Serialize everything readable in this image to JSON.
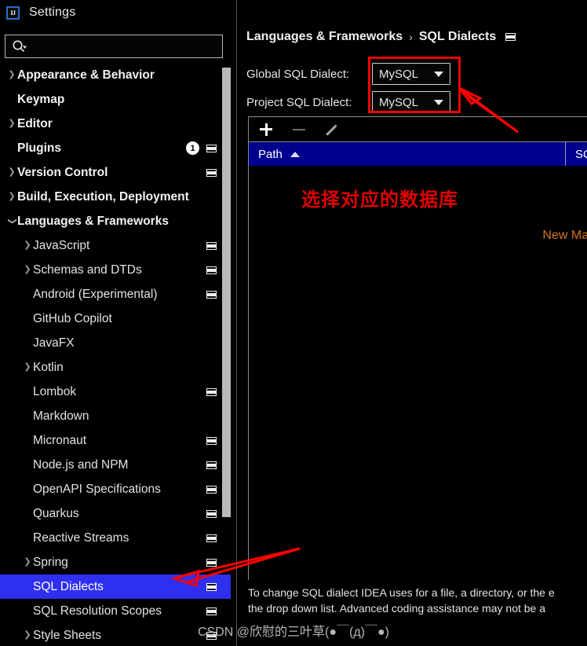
{
  "window": {
    "title": "Settings",
    "app_icon": "intellij-idea-icon"
  },
  "search": {
    "value": "",
    "placeholder": "",
    "icon": "search-icon"
  },
  "sidebar": {
    "scrollbar": "vertical-scrollbar",
    "items": [
      {
        "label": "Appearance & Behavior",
        "level": 0,
        "chevron": "chevron-right",
        "modified_icon": false,
        "badge": null,
        "selected": false
      },
      {
        "label": "Keymap",
        "level": 0,
        "chevron": "",
        "modified_icon": false,
        "badge": null,
        "selected": false
      },
      {
        "label": "Editor",
        "level": 0,
        "chevron": "chevron-right",
        "modified_icon": false,
        "badge": null,
        "selected": false
      },
      {
        "label": "Plugins",
        "level": 0,
        "chevron": "",
        "modified_icon": true,
        "badge": "1",
        "selected": false
      },
      {
        "label": "Version Control",
        "level": 0,
        "chevron": "chevron-right",
        "modified_icon": true,
        "badge": null,
        "selected": false
      },
      {
        "label": "Build, Execution, Deployment",
        "level": 0,
        "chevron": "chevron-right",
        "modified_icon": false,
        "badge": null,
        "selected": false
      },
      {
        "label": "Languages & Frameworks",
        "level": 0,
        "chevron": "chevron-down",
        "modified_icon": false,
        "badge": null,
        "selected": false
      },
      {
        "label": "JavaScript",
        "level": 1,
        "chevron": "chevron-right",
        "modified_icon": true,
        "badge": null,
        "selected": false
      },
      {
        "label": "Schemas and DTDs",
        "level": 1,
        "chevron": "chevron-right",
        "modified_icon": true,
        "badge": null,
        "selected": false
      },
      {
        "label": "Android (Experimental)",
        "level": 1,
        "chevron": "",
        "modified_icon": true,
        "badge": null,
        "selected": false
      },
      {
        "label": "GitHub Copilot",
        "level": 1,
        "chevron": "",
        "modified_icon": false,
        "badge": null,
        "selected": false
      },
      {
        "label": "JavaFX",
        "level": 1,
        "chevron": "",
        "modified_icon": false,
        "badge": null,
        "selected": false
      },
      {
        "label": "Kotlin",
        "level": 1,
        "chevron": "chevron-right",
        "modified_icon": false,
        "badge": null,
        "selected": false
      },
      {
        "label": "Lombok",
        "level": 1,
        "chevron": "",
        "modified_icon": true,
        "badge": null,
        "selected": false
      },
      {
        "label": "Markdown",
        "level": 1,
        "chevron": "",
        "modified_icon": false,
        "badge": null,
        "selected": false
      },
      {
        "label": "Micronaut",
        "level": 1,
        "chevron": "",
        "modified_icon": true,
        "badge": null,
        "selected": false
      },
      {
        "label": "Node.js and NPM",
        "level": 1,
        "chevron": "",
        "modified_icon": true,
        "badge": null,
        "selected": false
      },
      {
        "label": "OpenAPI Specifications",
        "level": 1,
        "chevron": "",
        "modified_icon": true,
        "badge": null,
        "selected": false
      },
      {
        "label": "Quarkus",
        "level": 1,
        "chevron": "",
        "modified_icon": true,
        "badge": null,
        "selected": false
      },
      {
        "label": "Reactive Streams",
        "level": 1,
        "chevron": "",
        "modified_icon": true,
        "badge": null,
        "selected": false
      },
      {
        "label": "Spring",
        "level": 1,
        "chevron": "chevron-right",
        "modified_icon": true,
        "badge": null,
        "selected": false
      },
      {
        "label": "SQL Dialects",
        "level": 1,
        "chevron": "",
        "modified_icon": true,
        "badge": null,
        "selected": true
      },
      {
        "label": "SQL Resolution Scopes",
        "level": 1,
        "chevron": "",
        "modified_icon": true,
        "badge": null,
        "selected": false
      },
      {
        "label": "Style Sheets",
        "level": 1,
        "chevron": "chevron-right",
        "modified_icon": true,
        "badge": null,
        "selected": false
      }
    ]
  },
  "content": {
    "breadcrumb": {
      "parent": "Languages & Frameworks",
      "separator": "›",
      "current": "SQL Dialects",
      "icon": "modified-marker-icon"
    },
    "fields": [
      {
        "label": "Global SQL Dialect:",
        "value": "MySQL"
      },
      {
        "label": "Project SQL Dialect:",
        "value": "MySQL"
      }
    ],
    "toolbar": {
      "add": "add-icon",
      "remove": "remove-icon",
      "edit": "edit-pencil-icon"
    },
    "table": {
      "columns": [
        {
          "label": "Path",
          "sort": "ascending"
        },
        {
          "label": "SQ"
        }
      ],
      "rows": [],
      "overlay_label": "New Map"
    },
    "footer_note_line1": "To change SQL dialect IDEA uses for a file, a directory, or the e",
    "footer_note_line2": "the drop down list. Advanced coding assistance may not be a"
  },
  "annotations": {
    "red_note": "选择对应的数据库",
    "highlight_box": "red-rectangle-around-dialect-dropdowns",
    "arrow_to_dropdown": "red-arrow-pointing-to-dropdowns",
    "arrow_to_sidebar": "red-arrow-pointing-to-sql-dialects",
    "accent_color": "#e00000"
  },
  "watermark": "CSDN @欣慰的三叶草(●￣(д)￣●)"
}
